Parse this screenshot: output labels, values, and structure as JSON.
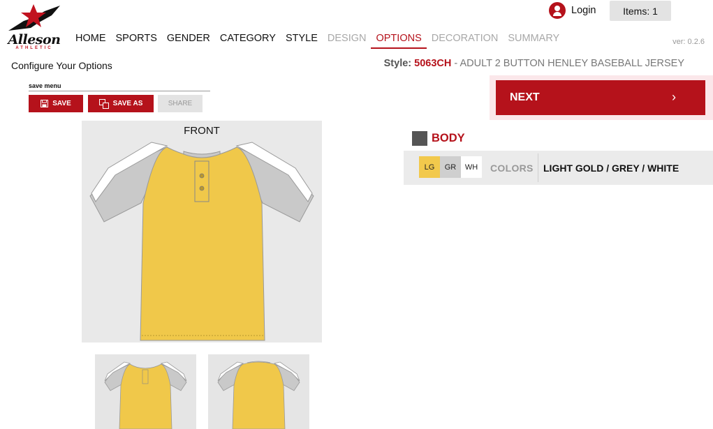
{
  "brand": {
    "name": "Alleson",
    "sub": "ATHLETIC"
  },
  "nav": {
    "items": [
      {
        "label": "HOME"
      },
      {
        "label": "SPORTS"
      },
      {
        "label": "GENDER"
      },
      {
        "label": "CATEGORY"
      },
      {
        "label": "STYLE"
      },
      {
        "label": "DESIGN"
      },
      {
        "label": "OPTIONS"
      },
      {
        "label": "DECORATION"
      },
      {
        "label": "SUMMARY"
      }
    ],
    "active": "OPTIONS"
  },
  "header": {
    "login_label": "Login",
    "items_label": "Items: 1",
    "version": "ver: 0.2.6"
  },
  "page": {
    "configure_title": "Configure Your Options",
    "style_label": "Style:",
    "style_code": "5063CH",
    "style_desc": "- ADULT 2 BUTTON HENLEY BASEBALL JERSEY"
  },
  "save_menu": {
    "title": "save menu",
    "save_label": "SAVE",
    "save_as_label": "SAVE AS",
    "share_label": "SHARE"
  },
  "preview": {
    "front_label": "FRONT"
  },
  "options": {
    "next_label": "NEXT",
    "section_label": "BODY",
    "colors_label": "COLORS",
    "selected_colors": "LIGHT GOLD / GREY / WHITE",
    "color_chips": [
      {
        "code": "LG",
        "color": "#f2c94c"
      },
      {
        "code": "GR",
        "color": "#cfcfcf"
      },
      {
        "code": "WH",
        "color": "#ffffff"
      }
    ]
  },
  "colors": {
    "accent": "#b5121b",
    "body_gold": "#f0c84a",
    "sleeve_grey": "#c9c9c9"
  }
}
